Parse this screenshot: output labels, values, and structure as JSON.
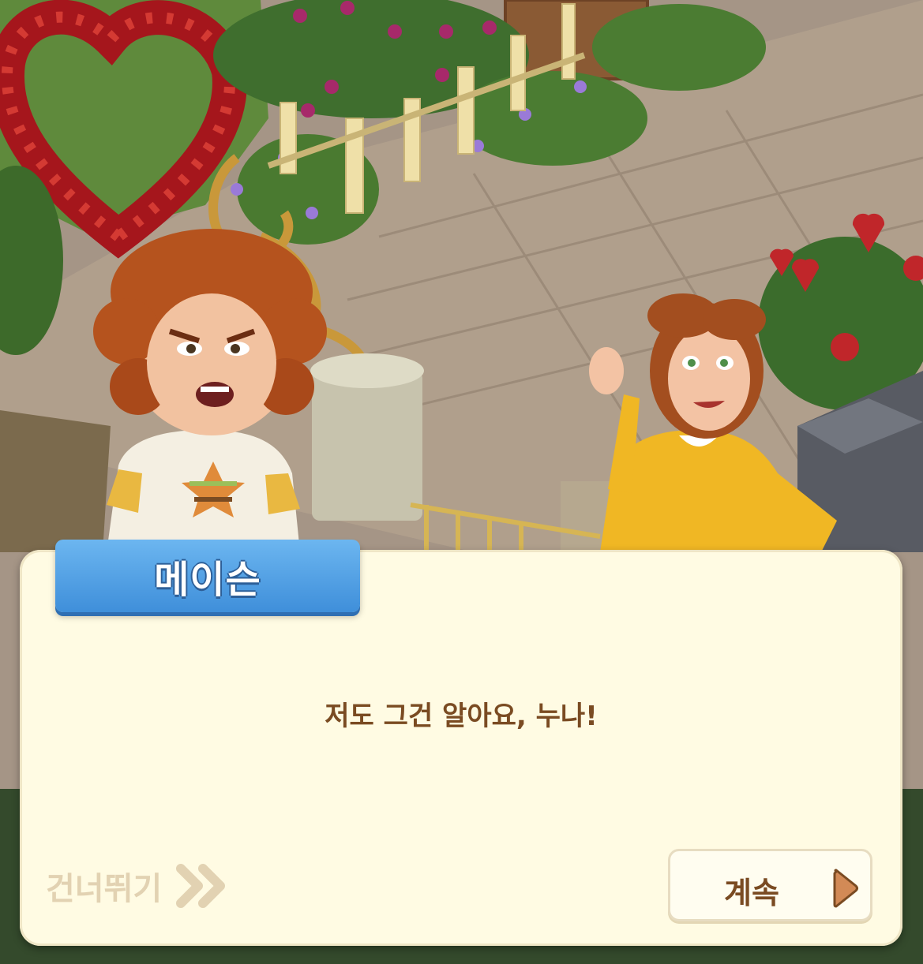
{
  "speaker": {
    "name": "메이슨"
  },
  "dialog": {
    "line": "저도 그건 알아요, 누나!"
  },
  "controls": {
    "skip_label": "건너뛰기",
    "continue_label": "계속"
  },
  "colors": {
    "panel_background": "#fffbe3",
    "name_tag": "#4a9be2",
    "dialog_text": "#7a4b22",
    "skip_text": "#e2d2b2",
    "continue_arrow": "#d28a56"
  },
  "icons": {
    "skip": "double-chevron-right-icon",
    "continue": "play-arrow-icon"
  }
}
